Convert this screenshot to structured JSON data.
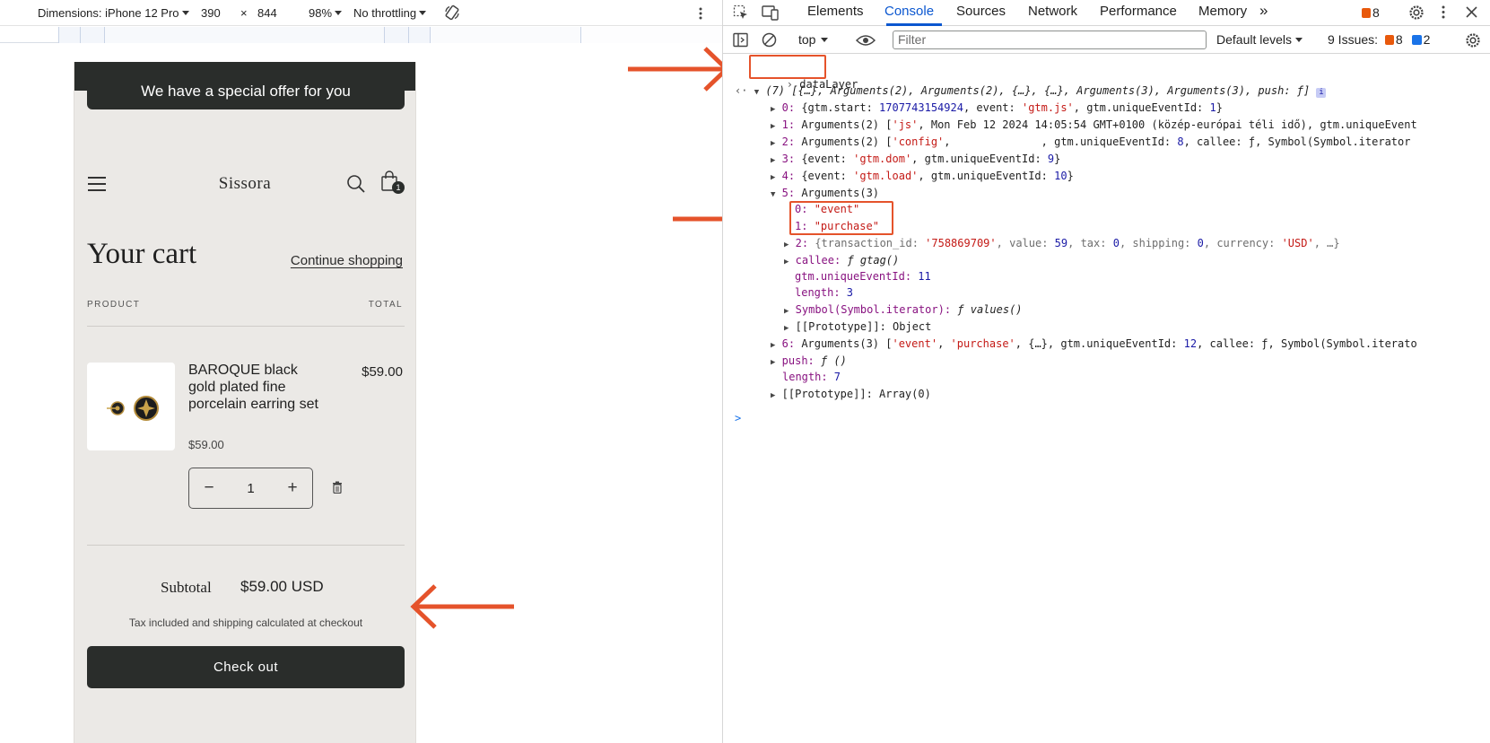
{
  "emulation_toolbar": {
    "dimensions_label": "Dimensions: iPhone 12 Pro",
    "width": "390",
    "times": "×",
    "height": "844",
    "zoom": "98%",
    "throttling": "No throttling"
  },
  "store": {
    "announcement": "We have a special offer for you",
    "brand": "Sissora",
    "cart_badge": "1",
    "cart_title": "Your cart",
    "continue_link": "Continue shopping",
    "col_product": "PRODUCT",
    "col_total": "TOTAL",
    "item": {
      "name": "BAROQUE black gold plated fine porcelain earring set",
      "price_total": "$59.00",
      "price_unit": "$59.00",
      "quantity": "1",
      "minus": "−",
      "plus": "+"
    },
    "subtotal_label": "Subtotal",
    "subtotal_value": "$59.00 USD",
    "tax_note": "Tax included and shipping calculated at checkout",
    "checkout_label": "Check out"
  },
  "devtools": {
    "tabs": [
      "Elements",
      "Console",
      "Sources",
      "Network",
      "Performance",
      "Memory"
    ],
    "more_tabs": "»",
    "error_count": "8",
    "context": "top",
    "filter_placeholder": "Filter",
    "levels": "Default levels",
    "issues_label": "9 Issues:",
    "issues_errors": "8",
    "issues_info": "2",
    "colors": {
      "accent": "#0b57d0",
      "annotation": "#e5532b"
    },
    "console": {
      "input": "dataLayer",
      "summary": "(7) [{…}, Arguments(2), Arguments(2), {…}, {…}, Arguments(3), Arguments(3), push: ƒ]",
      "info_glyph": "i",
      "rows": [
        {
          "idx": "0:",
          "text": " {gtm.start: ",
          "n1": "1707743154924",
          "t2": ", event: ",
          "s1": "'gtm.js'",
          "t3": ", gtm.uniqueEventId: ",
          "n2": "1",
          "t4": "}"
        },
        {
          "idx": "1:",
          "text": " Arguments(2) [",
          "s1": "'js'",
          "t2": ", Mon Feb 12 2024 14:05:54 GMT+0100 (közép-európai téli idő), gtm.uniqueEvent"
        },
        {
          "idx": "2:",
          "text": " Arguments(2) [",
          "s1": "'config'",
          "t2": ",              , gtm.uniqueEventId: ",
          "n1": "8",
          "t3": ", callee: ƒ, Symbol(Symbol.iterator"
        },
        {
          "idx": "3:",
          "text": " {event: ",
          "s1": "'gtm.dom'",
          "t2": ", gtm.uniqueEventId: ",
          "n1": "9",
          "t3": "}"
        },
        {
          "idx": "4:",
          "text": " {event: ",
          "s1": "'gtm.load'",
          "t2": ", gtm.uniqueEventId: ",
          "n1": "10",
          "t3": "}"
        },
        {
          "idx": "5:",
          "text": " Arguments(3)"
        }
      ],
      "arg0_key": "0:",
      "arg0_val": "\"event\"",
      "arg1_key": "1:",
      "arg1_val": "\"purchase\"",
      "arg2": {
        "key": "2:",
        "t1": " {transaction_id: ",
        "s1": "'758869709'",
        "t2": ", value: ",
        "n1": "59",
        "t3": ", tax: ",
        "n2": "0",
        "t4": ", shipping: ",
        "n3": "0",
        "t5": ", currency: ",
        "s2": "'USD'",
        "t6": ", …}"
      },
      "callee_key": "callee:",
      "callee_val": " ƒ gtag()",
      "uid_key": "gtm.uniqueEventId:",
      "uid_val": " 11",
      "len_key": "length:",
      "len_val": " 3",
      "iter_key": "Symbol(Symbol.iterator):",
      "iter_val": " ƒ values()",
      "proto_obj": "[[Prototype]]: Object",
      "row6": {
        "idx": "6:",
        "t1": " Arguments(3) [",
        "s1": "'event'",
        "t2": ", ",
        "s2": "'purchase'",
        "t3": ", {…}, gtm.uniqueEventId: ",
        "n1": "12",
        "t4": ", callee: ƒ, Symbol(Symbol.iterato"
      },
      "push_key": "push:",
      "push_val": " ƒ ()",
      "length_key": "length:",
      "length_val": " 7",
      "proto_arr": "[[Prototype]]: Array(0)",
      "prompt": ">"
    }
  }
}
